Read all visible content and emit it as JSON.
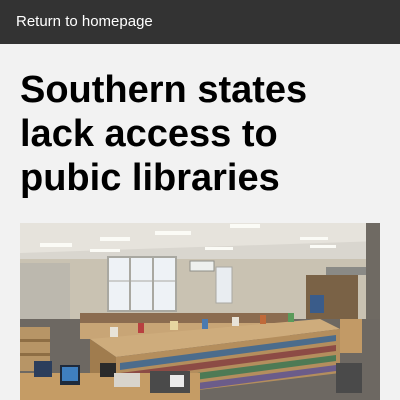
{
  "header": {
    "back_link": "Return to homepage"
  },
  "article": {
    "title": "Southern states lack access to pubic libraries"
  },
  "colors": {
    "header_bg": "#333333",
    "page_bg": "#f2f2f2",
    "text": "#000000"
  },
  "photo": {
    "subject": "library-interior-photo"
  }
}
